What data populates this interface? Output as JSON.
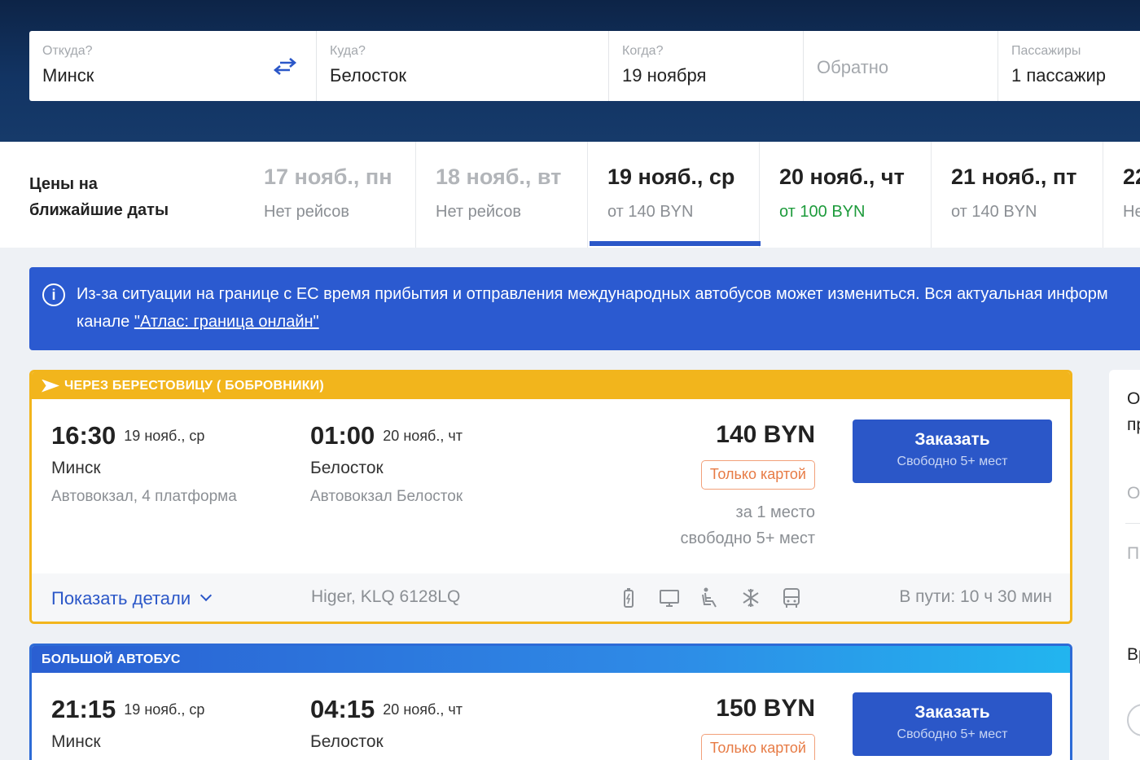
{
  "search": {
    "from": {
      "label": "Откуда?",
      "value": "Минск"
    },
    "to": {
      "label": "Куда?",
      "value": "Белосток"
    },
    "when": {
      "label": "Когда?",
      "value": "19 ноября"
    },
    "return": {
      "placeholder": "Обратно"
    },
    "passengers": {
      "label": "Пассажиры",
      "value": "1 пассажир"
    }
  },
  "dates": {
    "title_line1": "Цены на",
    "title_line2": "ближайшие даты",
    "items": [
      {
        "date": "17 нояб., пн",
        "price": "Нет рейсов"
      },
      {
        "date": "18 нояб., вт",
        "price": "Нет рейсов"
      },
      {
        "date": "19 нояб., ср",
        "price": "от 140 BYN"
      },
      {
        "date": "20 нояб., чт",
        "price": "от 100 BYN"
      },
      {
        "date": "21 нояб., пт",
        "price": "от 140 BYN"
      },
      {
        "date": "22",
        "price": "Не"
      }
    ]
  },
  "banner": {
    "line1": "Из-за ситуации на границе с ЕС время прибытия и отправления международных автобусов может измениться. Вся актуальная информ",
    "line2_prefix": "канале ",
    "link": "\"Атлас: граница онлайн\""
  },
  "trips": [
    {
      "tag": "ЧЕРЕЗ БЕРЕСТОВИЦУ ( БОБРОВНИКИ)",
      "dep_time": "16:30",
      "dep_date": "19 нояб., ср",
      "dep_city": "Минск",
      "dep_station": "Автовокзал, 4 платформа",
      "arr_time": "01:00",
      "arr_date": "20 нояб., чт",
      "arr_city": "Белосток",
      "arr_station": "Автовокзал Белосток",
      "price": "140 BYN",
      "payment": "Только картой",
      "per_seat": "за 1 место",
      "free_seats": "свободно 5+ мест",
      "order_label": "Заказать",
      "order_sub": "Свободно 5+ мест",
      "details": "Показать детали",
      "bus": "Higer, KLQ 6128LQ",
      "duration": "В пути: 10 ч 30 мин"
    },
    {
      "tag": "БОЛЬШОЙ АВТОБУС",
      "dep_time": "21:15",
      "dep_date": "19 нояб., ср",
      "dep_city": "Минск",
      "arr_time": "04:15",
      "arr_date": "20 нояб., чт",
      "arr_city": "Белосток",
      "price": "150 BYN",
      "payment": "Только картой",
      "order_label": "Заказать",
      "order_sub": "Свободно 5+ мест"
    }
  ],
  "side": {
    "l1": "О",
    "l2": "пр",
    "l3": "О",
    "l4": "П",
    "l5": "Вр"
  },
  "colors": {
    "accent": "#2b57c8",
    "cheap": "#1e9b3c",
    "tag_yellow": "#f2b51c",
    "payment": "#e77b45"
  }
}
